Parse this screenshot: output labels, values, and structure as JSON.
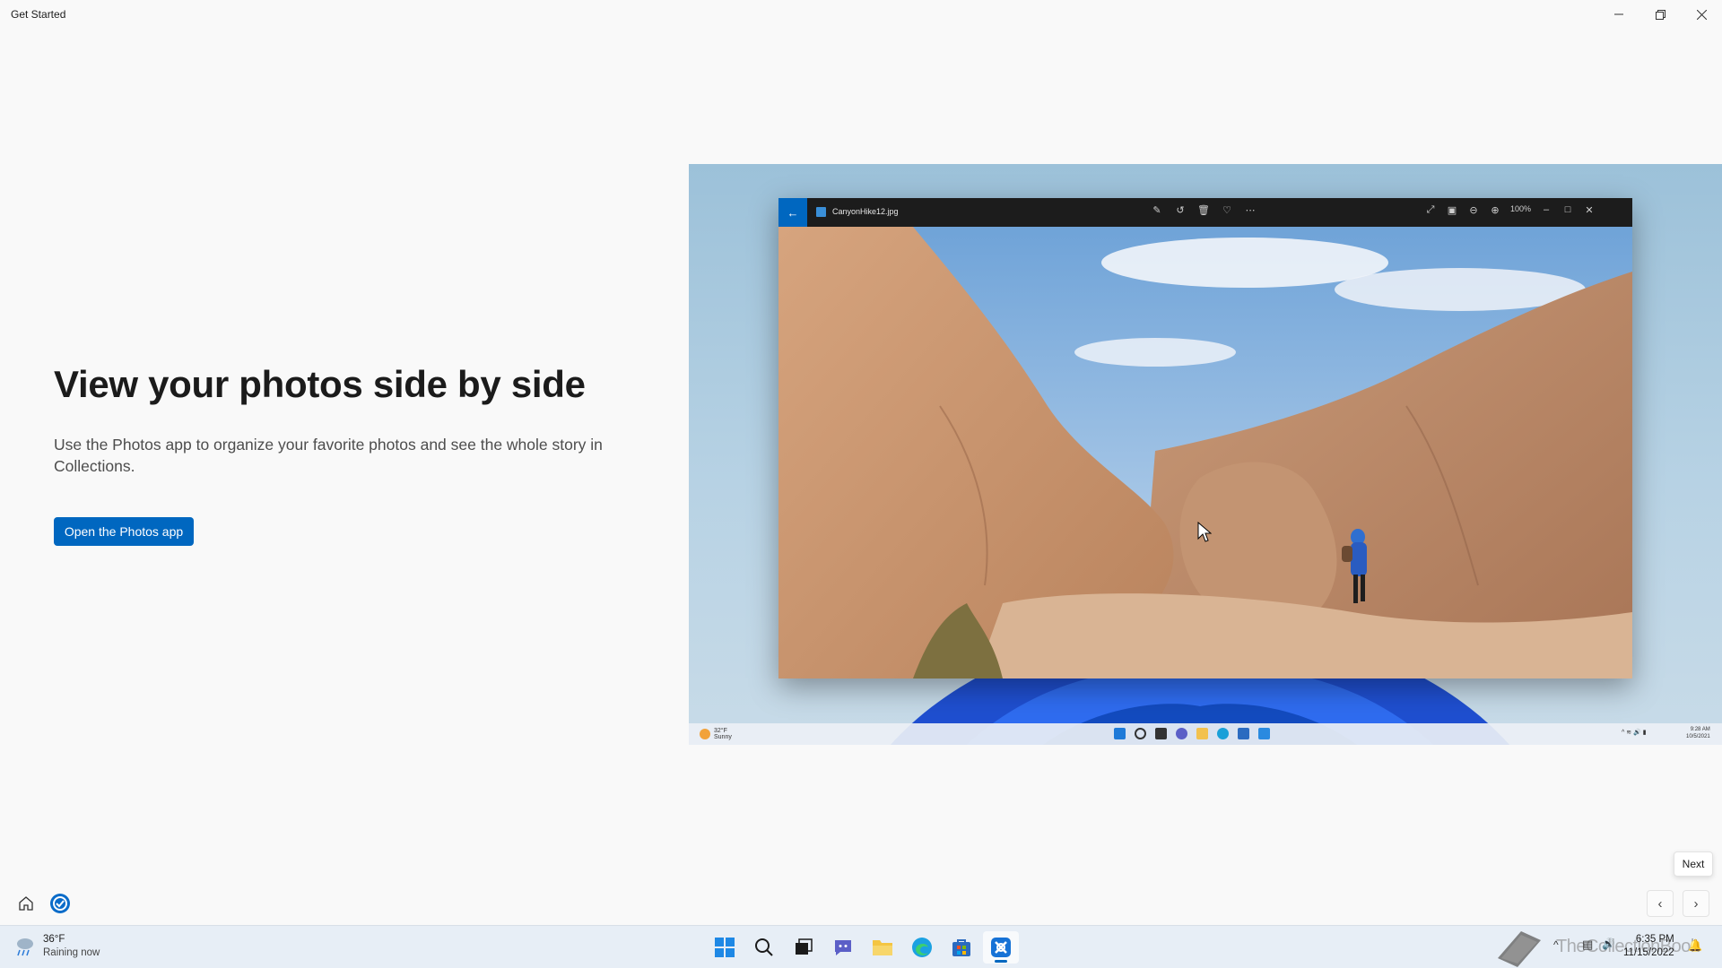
{
  "window": {
    "title": "Get Started",
    "minimize_icon": "minimize-icon",
    "restore_icon": "restore-icon",
    "close_icon": "close-icon"
  },
  "content": {
    "heading": "View your photos side by side",
    "description": "Use the Photos app to organize your favorite photos and see the whole story in Collections.",
    "primary_button": "Open the Photos app"
  },
  "hero": {
    "photos_window": {
      "filename": "CanyonHike12.jpg",
      "zoom": "100%",
      "toolbar_icons": [
        "edit-icon",
        "rotate-icon",
        "delete-icon",
        "heart-icon",
        "more-icon"
      ],
      "right_icons": [
        "fullscreen-icon",
        "slideshow-icon",
        "zoom-out-icon",
        "zoom-in-icon"
      ]
    },
    "mini_taskbar": {
      "temperature": "32°F",
      "condition": "Sunny",
      "time": "9:28 AM",
      "date": "10/5/2021"
    }
  },
  "navigation": {
    "next_tooltip": "Next",
    "prev_icon": "chevron-left-icon",
    "next_icon": "chevron-right-icon",
    "home_icon": "home-icon",
    "tips_icon": "tips-icon"
  },
  "taskbar": {
    "weather_temp": "36°F",
    "weather_condition": "Raining now",
    "watermark": "TheCollectionBook",
    "time": "6:35 PM",
    "date": "11/15/2022",
    "apps": [
      "start",
      "search",
      "task-view",
      "chat",
      "file-explorer",
      "edge",
      "store",
      "get-started"
    ]
  },
  "colors": {
    "accent": "#0067c0",
    "background": "#f9f9f9",
    "taskbar": "#e7eef6"
  }
}
